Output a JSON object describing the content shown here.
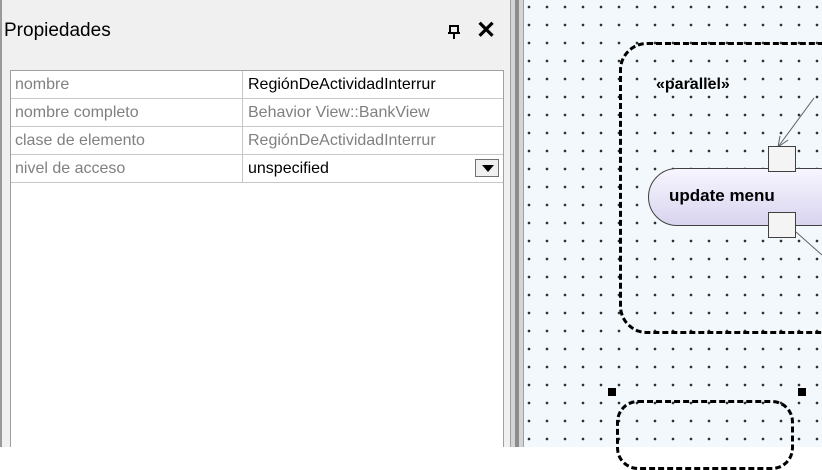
{
  "panel": {
    "title": "Propiedades",
    "pin_icon": "pin-icon",
    "close_icon": "close-icon",
    "close_glyph": "✕"
  },
  "properties": [
    {
      "key": "nombre",
      "value": "RegiónDeActividadInterrur"
    },
    {
      "key": "nombre completo",
      "value": "Behavior View::BankView"
    },
    {
      "key": "clase de elemento",
      "value": "RegiónDeActividadInterrur"
    },
    {
      "key": "nivel de acceso",
      "value": "unspecified"
    }
  ],
  "diagram": {
    "stereotype": "«parallel»",
    "action_label": "update menu"
  }
}
